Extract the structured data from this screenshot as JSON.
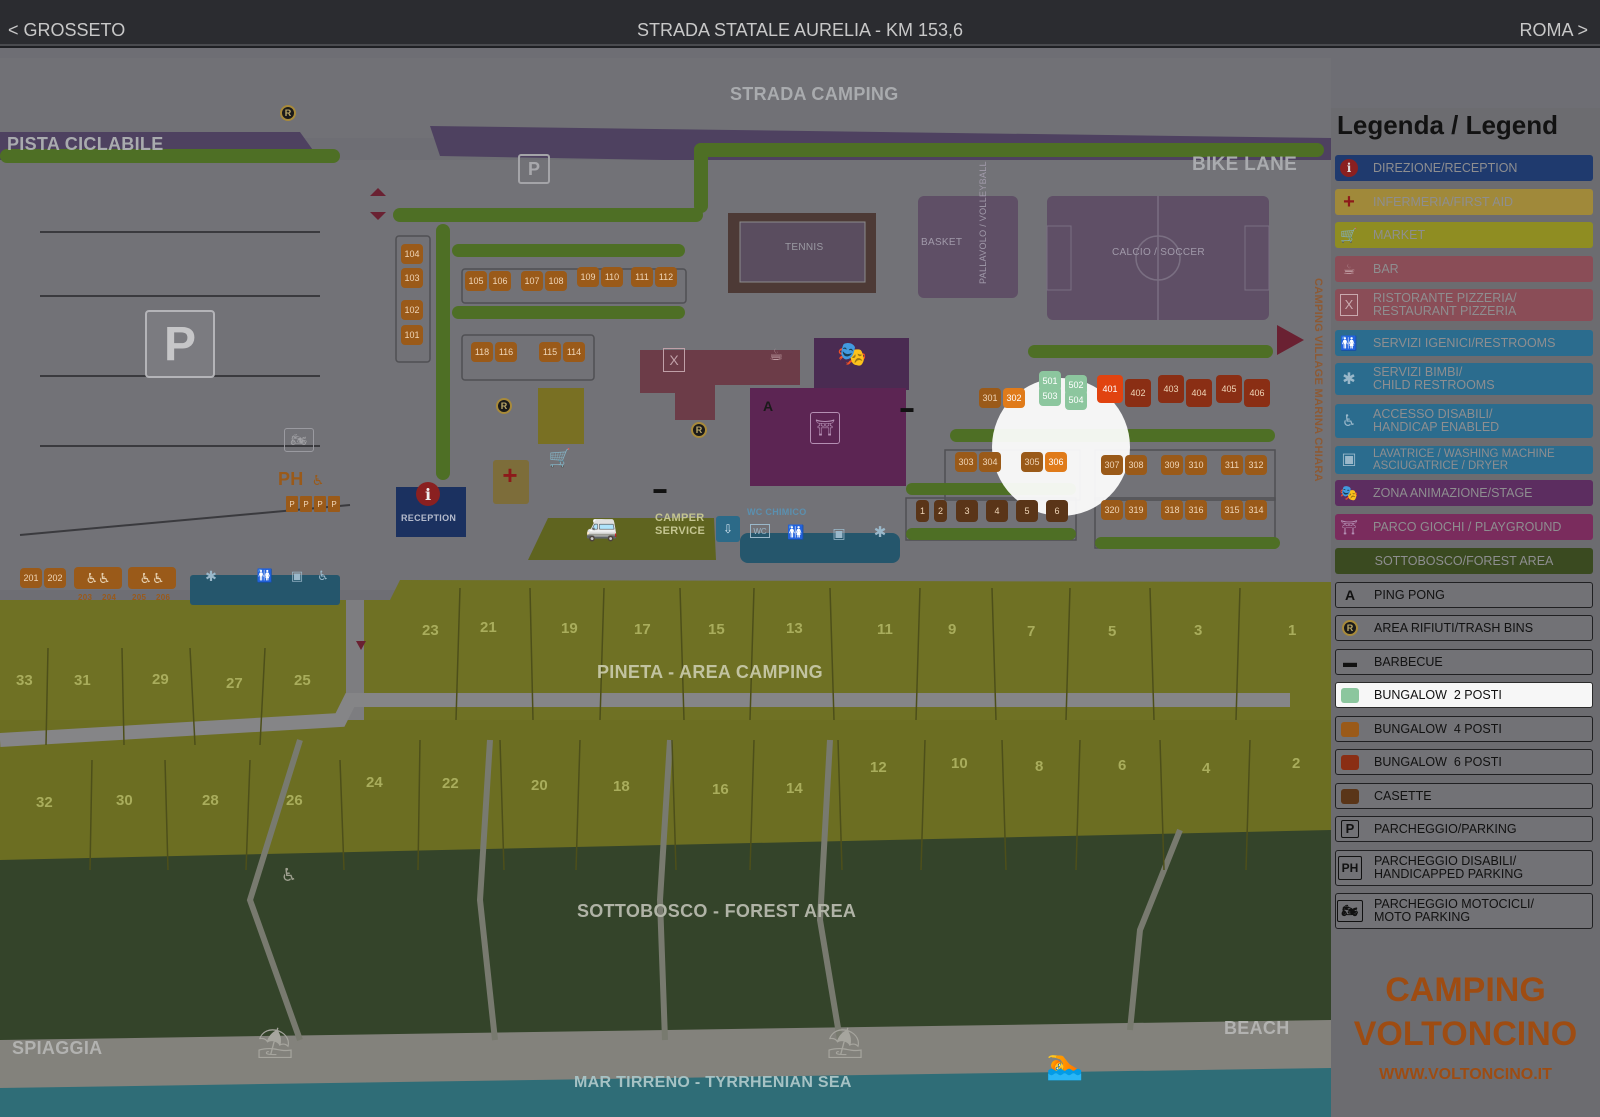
{
  "header": {
    "nav_left": "< GROSSETO",
    "road": "STRADA STATALE AURELIA - KM 153,6",
    "nav_right": "ROMA >"
  },
  "map_labels": {
    "strada_camping": "STRADA CAMPING",
    "pista_ciclabile": "PISTA CICLABILE",
    "bike_lane": "BIKE LANE",
    "camping_village": "CAMPING VILLAGE MARINA CHIARA",
    "pineta": "PINETA - AREA CAMPING",
    "sottobosco": "SOTTOBOSCO - FOREST AREA",
    "spiaggia": "SPIAGGIA",
    "beach": "BEACH",
    "sea": "MAR TIRRENO - TYRRHENIAN SEA",
    "tennis": "TENNIS",
    "basket": "BASKET",
    "pallavolo": "PALLAVOLO / VOLLEYBALL",
    "calcio": "CALCIO / SOCCER",
    "reception": "RECEPTION",
    "camper_service": "CAMPER\nSERVICE",
    "wc_chimico": "WC CHIMICO",
    "ph": "PH",
    "parking_p": "P",
    "ping_pong_a": "A",
    "trash_r": "R"
  },
  "units": {
    "bungalow4_top": [
      "104",
      "103",
      "102",
      "101",
      "105",
      "106",
      "107",
      "108",
      "109",
      "110",
      "111",
      "112",
      "118",
      "116",
      "115",
      "114"
    ],
    "bungalow4_bottom": [
      "201",
      "202"
    ],
    "accessible_units": [
      "203",
      "204",
      "205",
      "206"
    ],
    "bungalow4_centre": [
      "301",
      "302",
      "303",
      "304",
      "305",
      "306"
    ],
    "bungalow2": [
      "501",
      "502",
      "503",
      "504"
    ],
    "bungalow6": [
      "401",
      "402",
      "403",
      "404",
      "405",
      "406"
    ],
    "casette": [
      "1",
      "2",
      "3",
      "4",
      "5",
      "6"
    ],
    "bungalow_row_lower": [
      "307",
      "308",
      "309",
      "310",
      "311",
      "312",
      "320",
      "319",
      "318",
      "316",
      "315",
      "314"
    ],
    "parking_ph": [
      "P",
      "P",
      "P",
      "P"
    ]
  },
  "pitches": {
    "row1": [
      "23",
      "21",
      "19",
      "17",
      "15",
      "13",
      "11",
      "9",
      "7",
      "5",
      "3",
      "1"
    ],
    "row1_left": [
      "33",
      "31",
      "29",
      "27",
      "25"
    ],
    "row2": [
      "24",
      "22",
      "20",
      "18",
      "16",
      "14",
      "12",
      "10",
      "8",
      "6",
      "4",
      "2"
    ],
    "row2_left": [
      "32",
      "30",
      "28",
      "26"
    ]
  },
  "legend": {
    "title": "Legenda / Legend",
    "items": [
      {
        "label": "DIREZIONE/RECEPTION",
        "color": "#1f3a6e",
        "icon": "info-icon"
      },
      {
        "label": "INFERMERIA/FIRST AID",
        "color": "#a0893a",
        "icon": "first-aid-cross-icon"
      },
      {
        "label": "MARKET",
        "color": "#8f8d22",
        "icon": "shopping-cart-icon"
      },
      {
        "label": "BAR",
        "color": "#8a4d57",
        "icon": "coffee-cup-icon"
      },
      {
        "label": "RISTORANTE PIZZERIA/\nRESTAURANT PIZZERIA",
        "color": "#8a4d57",
        "icon": "cutlery-icon"
      },
      {
        "label": "SERVIZI IGENICI/RESTROOMS",
        "color": "#2b6c8e",
        "icon": "restroom-icon"
      },
      {
        "label": "SERVIZI BIMBI/\nCHILD RESTROOMS",
        "color": "#2b6c8e",
        "icon": "child-icon"
      },
      {
        "label": "ACCESSO DISABILI/\nHANDICAP ENABLED",
        "color": "#2b6c8e",
        "icon": "wheelchair-icon"
      },
      {
        "label": "LAVATRICE / WASHING MACHINE\nASCIUGATRICE / DRYER",
        "color": "#2b6c8e",
        "icon": "washing-machine-icon"
      },
      {
        "label": "ZONA ANIMAZIONE/STAGE",
        "color": "#5c2d60",
        "icon": "theatre-masks-icon"
      },
      {
        "label": "PARCO GIOCHI / PLAYGROUND",
        "color": "#7a2c5d",
        "icon": "swing-icon"
      },
      {
        "label": "SOTTOBOSCO/FOREST AREA",
        "color": "#3a4a20",
        "icon": ""
      },
      {
        "label": "PING PONG",
        "icon": "letter-a-icon",
        "symbol": "A"
      },
      {
        "label": "AREA RIFIUTI/TRASH BINS",
        "icon": "trash-r-icon",
        "symbol": "R"
      },
      {
        "label": "BARBECUE",
        "icon": "barbecue-icon"
      },
      {
        "label": "BUNGALOW  2 POSTI",
        "icon": "bungalow-2-swatch",
        "swatch": "#8cc69e",
        "highlight": true
      },
      {
        "label": "BUNGALOW  4 POSTI",
        "icon": "bungalow-4-swatch",
        "swatch": "#9a5a19"
      },
      {
        "label": "BUNGALOW  6 POSTI",
        "icon": "bungalow-6-swatch",
        "swatch": "#8a2e14"
      },
      {
        "label": "CASETTE",
        "icon": "casette-swatch",
        "swatch": "#5a3518"
      },
      {
        "label": "PARCHEGGIO/PARKING",
        "icon": "parking-p-icon",
        "symbol": "P"
      },
      {
        "label": "PARCHEGGIO DISABILI/\nHANDICAPPED PARKING",
        "icon": "parking-ph-icon",
        "symbol": "PH"
      },
      {
        "label": "PARCHEGGIO MOTOCICLI/\nMOTO PARKING",
        "icon": "motorcycle-icon"
      }
    ],
    "brand_line1": "CAMPING",
    "brand_line2": "VOLTONCINO",
    "url": "WWW.VOLTONCINO.IT"
  },
  "colors": {
    "overlay": "#6e6e74",
    "highlight": "#ffffff",
    "brand": "#9e4c12"
  }
}
